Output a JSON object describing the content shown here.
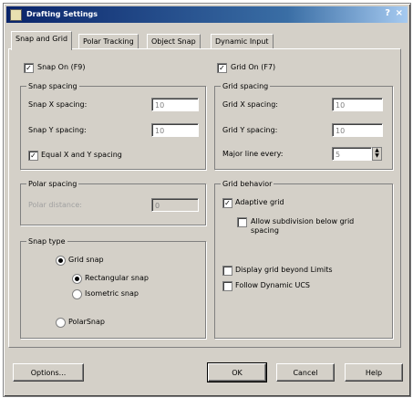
{
  "window": {
    "title": "Drafting Settings",
    "help_glyph": "?",
    "close_glyph": "×"
  },
  "tabs": [
    {
      "label": "Snap and Grid",
      "active": true
    },
    {
      "label": "Polar Tracking",
      "active": false
    },
    {
      "label": "Object Snap",
      "active": false
    },
    {
      "label": "Dynamic Input",
      "active": false
    }
  ],
  "snap": {
    "snap_on_label": "Snap On (F9)",
    "snap_on_checked": true,
    "spacing_group": "Snap spacing",
    "x_label": "Snap X spacing:",
    "x_value": "10",
    "y_label": "Snap Y spacing:",
    "y_value": "10",
    "equal_label": "Equal X and Y spacing",
    "equal_checked": true
  },
  "polar": {
    "group": "Polar spacing",
    "distance_label": "Polar distance:",
    "distance_value": "0"
  },
  "snap_type": {
    "group": "Snap type",
    "grid_snap": "Grid snap",
    "rectangular": "Rectangular snap",
    "isometric": "Isometric snap",
    "polar_snap": "PolarSnap",
    "selected": "rectangular"
  },
  "grid": {
    "grid_on_label": "Grid On (F7)",
    "grid_on_checked": true,
    "spacing_group": "Grid spacing",
    "x_label": "Grid X spacing:",
    "x_value": "10",
    "y_label": "Grid Y spacing:",
    "y_value": "10",
    "major_label": "Major line every:",
    "major_value": "5"
  },
  "behavior": {
    "group": "Grid behavior",
    "adaptive": "Adaptive grid",
    "adaptive_checked": true,
    "subdivision": "Allow subdivision below grid spacing",
    "subdivision_checked": false,
    "beyond_limits": "Display grid beyond Limits",
    "beyond_checked": false,
    "follow_ucs": "Follow Dynamic UCS",
    "follow_checked": false
  },
  "buttons": {
    "options": "Options...",
    "ok": "OK",
    "cancel": "Cancel",
    "help": "Help"
  }
}
